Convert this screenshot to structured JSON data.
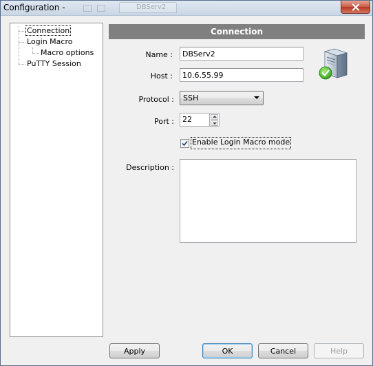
{
  "window": {
    "title": "Configuration -",
    "background_tab_label": "DBServ2"
  },
  "tree": {
    "items": [
      {
        "label": "Connection"
      },
      {
        "label": "Login Macro"
      },
      {
        "label": "Macro options"
      },
      {
        "label": "PuTTY Session"
      }
    ]
  },
  "panel": {
    "header": "Connection",
    "name_label": "Name :",
    "name_value": "DBServ2",
    "host_label": "Host :",
    "host_value": "10.6.55.99",
    "protocol_label": "Protocol :",
    "protocol_value": "SSH",
    "port_label": "Port :",
    "port_value": "22",
    "macro_checkbox_label": "Enable Login Macro mode",
    "macro_checked": true,
    "description_label": "Description :",
    "description_value": ""
  },
  "icons": {
    "close": "close-icon",
    "server": "server-connected-icon",
    "dropdown": "chevron-down-icon"
  },
  "buttons": {
    "apply": "Apply",
    "ok": "OK",
    "cancel": "Cancel",
    "help": "Help"
  },
  "colors": {
    "header_band": "#808080",
    "close_button": "#c75b45",
    "default_button_border": "#3c7fb1"
  }
}
